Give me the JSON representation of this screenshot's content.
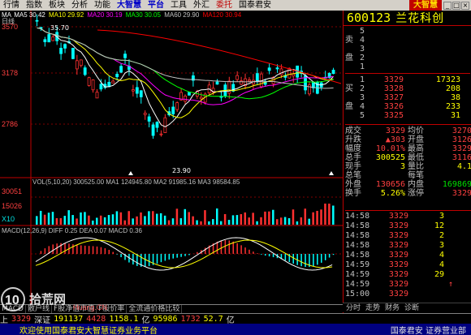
{
  "menubar": {
    "items": [
      "行情",
      "指数",
      "板块",
      "分析",
      "功能",
      "大智慧",
      "平台",
      "工具",
      "外汇",
      "委托",
      "国泰君安"
    ],
    "highlighted": [
      5,
      6
    ],
    "red": [
      9
    ],
    "brand": "大智慧",
    "window_buttons": [
      "_",
      "□",
      "×"
    ]
  },
  "kline": {
    "period_label": "日线",
    "ma_legend": [
      {
        "label": "MA",
        "value": "",
        "color": "#ffffff"
      },
      {
        "label": "MA5",
        "value": "30.42",
        "color": "#ffffff"
      },
      {
        "label": "MA10",
        "value": "29.92",
        "color": "#ffff00"
      },
      {
        "label": "MA20",
        "value": "30.19",
        "color": "#ff00ff"
      },
      {
        "label": "MA30",
        "value": "30.05",
        "color": "#00ff00"
      },
      {
        "label": "MA60",
        "value": "29.90",
        "color": "#c0c0c0"
      },
      {
        "label": "MA120",
        "value": "30.94",
        "color": "#ff0000"
      }
    ],
    "y_ticks": [
      "3570",
      "3178",
      "2786"
    ],
    "high_label": "35.70",
    "low_label": "23.90",
    "vol_legend": "VOL(5,10,20)  300525.00  MA1 124945.80  MA2 91985.16  MA3 98584.85",
    "vol_ticks": [
      "30051",
      "15026",
      "X10"
    ],
    "macd_legend": "MACD(12,26,9)  DIFF 0.25  DEA 0.07  MACD 0.36"
  },
  "right": {
    "code": "600123",
    "name": "兰花科创",
    "sell_label": "卖盘",
    "buy_label": "买盘",
    "sells": [
      {
        "n": "5",
        "price": "",
        "vol": ""
      },
      {
        "n": "4",
        "price": "",
        "vol": ""
      },
      {
        "n": "3",
        "price": "",
        "vol": ""
      },
      {
        "n": "2",
        "price": "",
        "vol": ""
      },
      {
        "n": "1",
        "price": "",
        "vol": ""
      }
    ],
    "buys": [
      {
        "n": "1",
        "price": "3329",
        "vol": "17323"
      },
      {
        "n": "2",
        "price": "3328",
        "vol": "208"
      },
      {
        "n": "3",
        "price": "3327",
        "vol": "38"
      },
      {
        "n": "4",
        "price": "3326",
        "vol": "233"
      },
      {
        "n": "5",
        "price": "3325",
        "vol": "31"
      }
    ],
    "stats": [
      {
        "l1": "成交",
        "v1": "3329",
        "c1": "red",
        "l2": "均价",
        "v2": "3270",
        "c2": "red"
      },
      {
        "l1": "升跌",
        "v1": "▲303",
        "c1": "red",
        "l2": "开盘",
        "v2": "3126",
        "c2": "red"
      },
      {
        "l1": "幅度",
        "v1": "10.01%",
        "c1": "red",
        "l2": "最高",
        "v2": "3329",
        "c2": "red"
      },
      {
        "l1": "总手",
        "v1": "300525",
        "c1": "yel",
        "l2": "最低",
        "v2": "3116",
        "c2": "red"
      },
      {
        "l1": "现手",
        "v1": "3",
        "c1": "yel",
        "l2": "量比",
        "v2": "4.1",
        "c2": "yel"
      },
      {
        "l1": "总笔",
        "v1": "",
        "c1": "yel",
        "l2": "每笔",
        "v2": "",
        "c2": "yel"
      },
      {
        "l1": "外盘",
        "v1": "130656",
        "c1": "red",
        "l2": "内盘",
        "v2": "169869",
        "c2": "grn"
      },
      {
        "l1": "换手",
        "v1": "5.26%",
        "c1": "yel",
        "l2": "涨停",
        "v2": "3329",
        "c2": "red"
      }
    ],
    "ticks": [
      {
        "t": "14:58",
        "p": "3329",
        "v": "3",
        "f": ""
      },
      {
        "t": "14:58",
        "p": "3329",
        "v": "12",
        "f": ""
      },
      {
        "t": "14:58",
        "p": "3329",
        "v": "2",
        "f": ""
      },
      {
        "t": "14:58",
        "p": "3329",
        "v": "3",
        "f": ""
      },
      {
        "t": "14:58",
        "p": "3329",
        "v": "4",
        "f": ""
      },
      {
        "t": "14:59",
        "p": "3329",
        "v": "4",
        "f": ""
      },
      {
        "t": "14:59",
        "p": "3329",
        "v": "29",
        "f": ""
      },
      {
        "t": "14:59",
        "p": "3329",
        "v": "",
        "f": "↑"
      },
      {
        "t": "15:00",
        "p": "3329",
        "v": "",
        "f": ""
      }
    ],
    "tabs": [
      "分时",
      "走势",
      "财务",
      "诊断"
    ]
  },
  "bottom_tabs": [
    "MACD",
    "散户线",
    "F股净值市值",
    "F股价率",
    "全流通价格比较"
  ],
  "statusbar": {
    "line1": [
      {
        "text": "上",
        "c": "wht"
      },
      {
        "text": "3329",
        "c": "red"
      },
      {
        "text": "深证",
        "c": "wht"
      },
      {
        "text": "191137",
        "c": "yel"
      },
      {
        "text": "4428",
        "c": "red"
      },
      {
        "text": "1158.1",
        "c": "yel"
      },
      {
        "text": "亿",
        "c": "wht"
      },
      {
        "text": "95986",
        "c": "yel"
      },
      {
        "text": "1732",
        "c": "red"
      },
      {
        "text": "52.7",
        "c": "yel"
      },
      {
        "text": "亿",
        "c": "wht"
      }
    ],
    "line2_text": "欢迎使用国泰君安大智慧证券业务平台",
    "line2_right": "国泰君安 证券营业部"
  },
  "watermark": "10 拾荒网 Huang.CN"
}
